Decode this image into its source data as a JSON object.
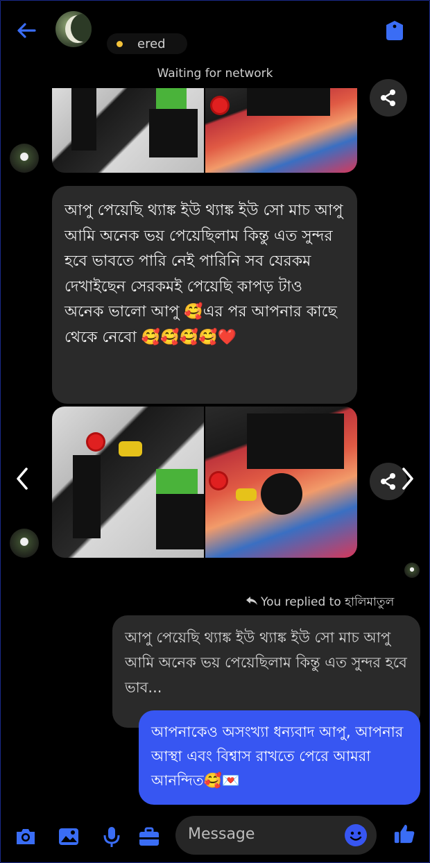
{
  "header": {
    "status_text": "ered",
    "network_text": "Waiting for network"
  },
  "messages": {
    "incoming_text": "আপু পেয়েছি থ্যাঙ্ক ইউ থ্যাঙ্ক ইউ সো মাচ আপু আমি অনেক ভয় পেয়েছিলাম কিন্তু এত সুন্দর হবে ভাবতে পারি নেই  পারিনি সব যেরকম দেখাইছেন সেরকমই পেয়েছি কাপড় টাও অনেক ভালো আপু 🥰এর পর আপনার কাছে থেকে নেবো 🥰🥰🥰🥰❤️",
    "reply_label": "You replied to হালিমাতুল",
    "quoted_text": "আপু পেয়েছি থ্যাঙ্ক ইউ থ্যাঙ্ক ইউ সো মাচ আপু আমি অনেক ভয় পেয়েছিলাম কিন্তু এত সুন্দর হবে ভাব...",
    "outgoing_text": "আপনাকেও অসংখ্যা ধন্যবাদ আপু, আপনার আস্থা এবং বিশ্বাস রাখতে পেরে আমরা আনন্দিত🥰💌"
  },
  "composer": {
    "placeholder": "Message"
  },
  "colors": {
    "accent": "#3756f2",
    "bubble_in": "#2a2a2a",
    "background": "#000000"
  },
  "icons": [
    "back-arrow-icon",
    "shield-icon",
    "share-icon",
    "chevron-left-icon",
    "chevron-right-icon",
    "reply-arrow-icon",
    "camera-icon",
    "gallery-icon",
    "microphone-icon",
    "briefcase-icon",
    "emoji-icon",
    "thumbs-up-icon"
  ]
}
